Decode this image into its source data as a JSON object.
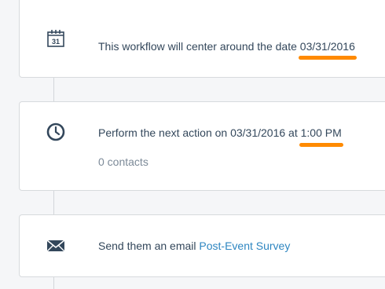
{
  "colors": {
    "accent": "#ff8a00",
    "link": "#2e86c1"
  },
  "steps": [
    {
      "icon": "calendar-icon",
      "calendar_day": "31",
      "text": "This workflow will center around the date ",
      "highlight": "03/31/2016"
    },
    {
      "icon": "clock-icon",
      "text": "Perform the next action on 03/31/2016 at ",
      "highlight": "1:00 PM",
      "contacts": "0 contacts"
    },
    {
      "icon": "envelope-icon",
      "text": "Send them an email ",
      "link": "Post-Event Survey"
    }
  ]
}
